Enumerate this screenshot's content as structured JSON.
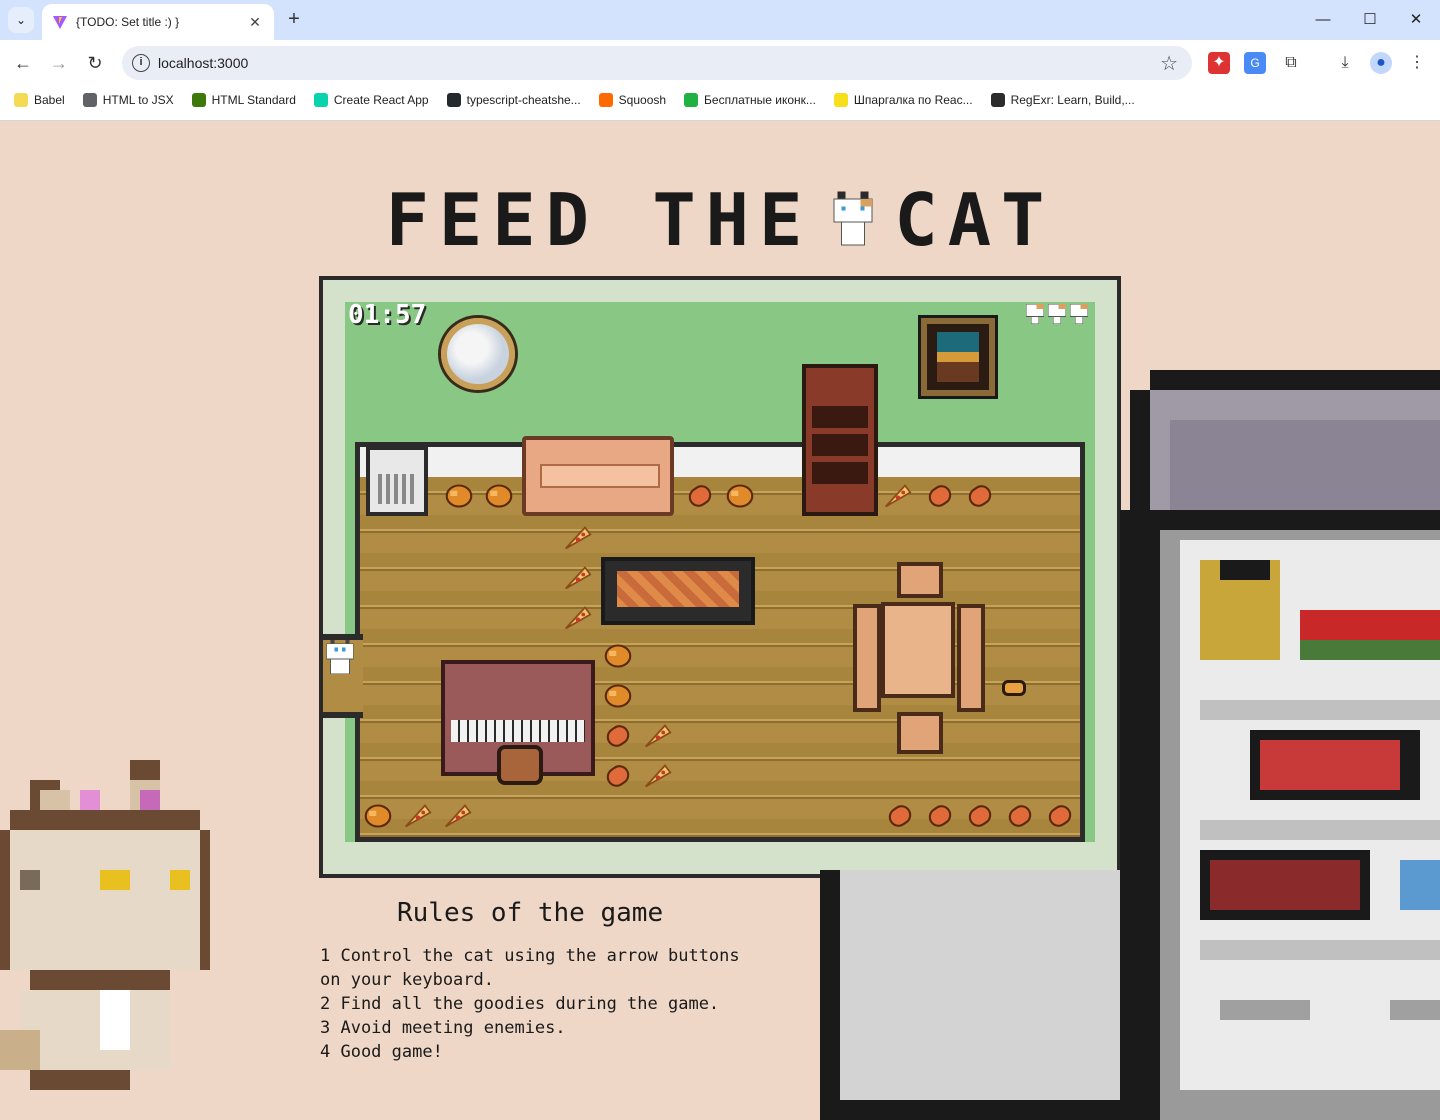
{
  "browser": {
    "tab_title": "{TODO: Set title :) }",
    "url": "localhost:3000",
    "bookmarks": [
      {
        "label": "Babel",
        "icon": "babel-icon",
        "color": "#f5da55"
      },
      {
        "label": "HTML to JSX",
        "icon": "globe-icon",
        "color": "#5f6368"
      },
      {
        "label": "HTML Standard",
        "icon": "whatwg-icon",
        "color": "#3c790a"
      },
      {
        "label": "Create React App",
        "icon": "react-icon",
        "color": "#09d3ac"
      },
      {
        "label": "typescript-cheatshe...",
        "icon": "github-icon",
        "color": "#24292e"
      },
      {
        "label": "Squoosh",
        "icon": "squoosh-icon",
        "color": "#ff6a00"
      },
      {
        "label": "Бесплатные иконк...",
        "icon": "icons8-icon",
        "color": "#1fb141"
      },
      {
        "label": "Шпаргалка по Reac...",
        "icon": "js-icon",
        "color": "#f7df1e"
      },
      {
        "label": "RegExr: Learn, Build,...",
        "icon": "regexr-icon",
        "color": "#2b2b2b"
      }
    ]
  },
  "page": {
    "title_left": "FEED THE",
    "title_right": "CAT",
    "accent_bg": "#efd7c7"
  },
  "game": {
    "timer": "01:57",
    "lives": 3
  },
  "rules": {
    "title": "Rules of the game",
    "items": [
      "1 Control the cat using the arrow buttons",
      "on your keyboard.",
      "2 Find all the goodies during the game.",
      "3 Avoid meeting enemies.",
      "4 Good game!"
    ]
  }
}
